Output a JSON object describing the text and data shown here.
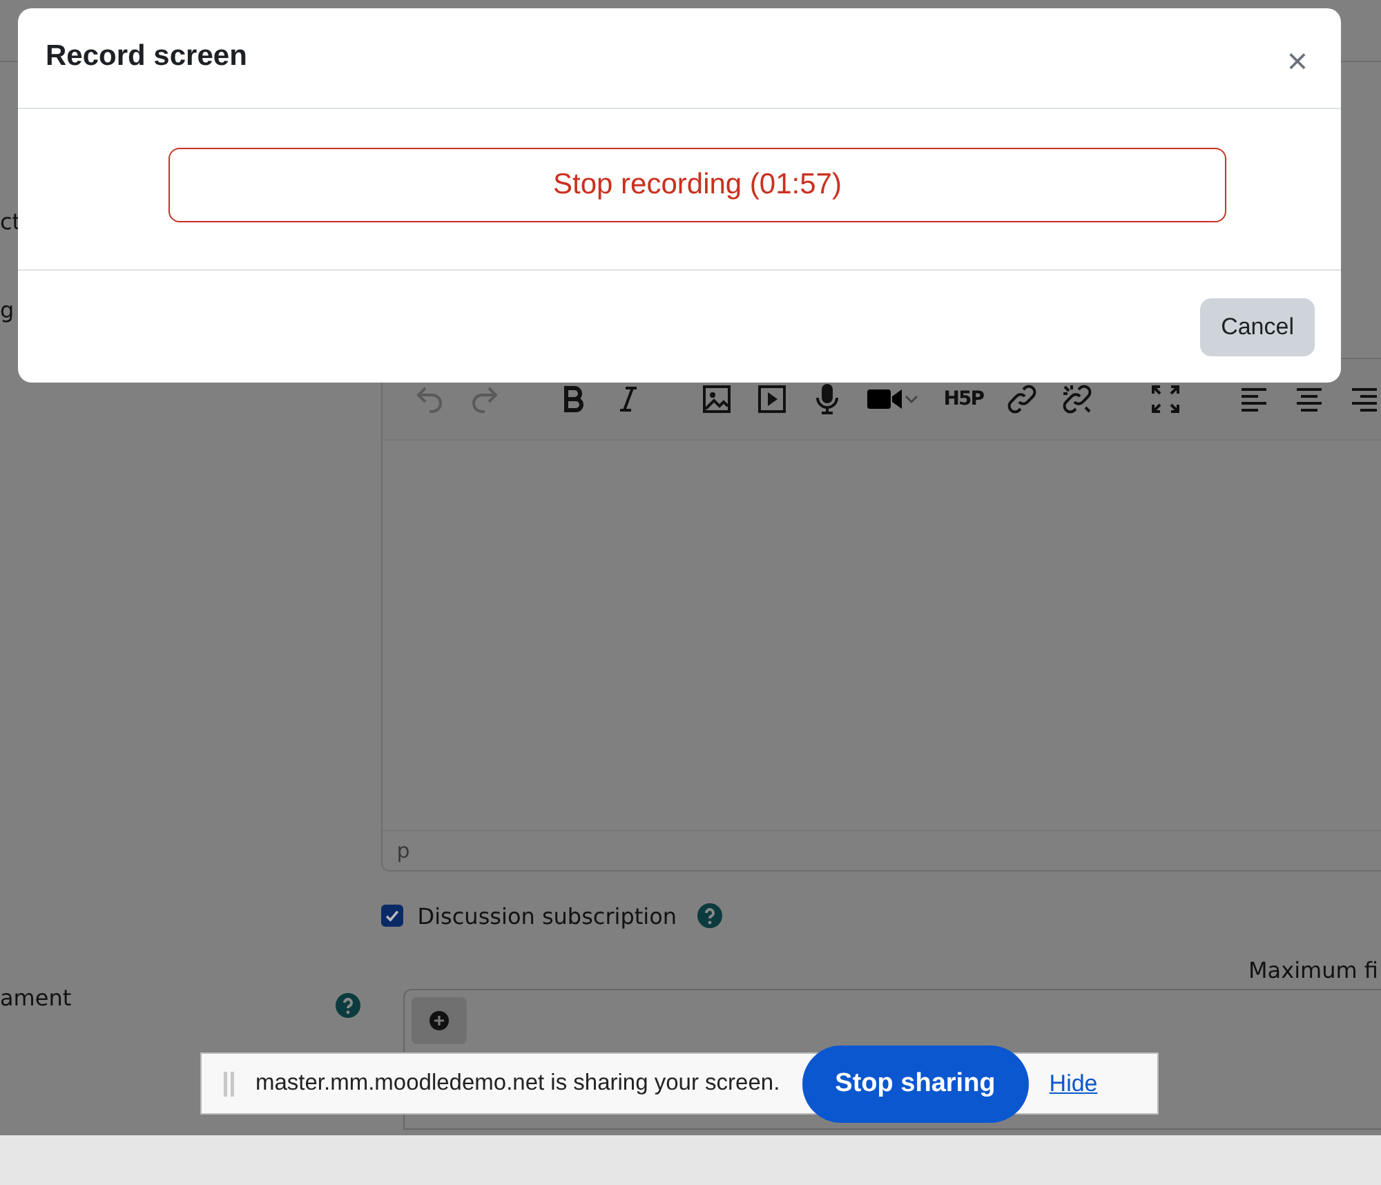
{
  "page": {
    "label_fragments": [
      "ct",
      "g"
    ],
    "editor": {
      "h5p_label": "H5P",
      "status_path": "p"
    },
    "subscription": {
      "label": "Discussion subscription",
      "checked": true
    },
    "attachment": {
      "label_fragment": "ament",
      "max_label": "Maximum fi"
    }
  },
  "modal": {
    "title": "Record screen",
    "close": "×",
    "record_button": "Stop recording (01:57)",
    "cancel": "Cancel"
  },
  "share_bar": {
    "message": "master.mm.moodledemo.net is sharing your screen.",
    "stop": "Stop sharing",
    "hide": "Hide"
  }
}
